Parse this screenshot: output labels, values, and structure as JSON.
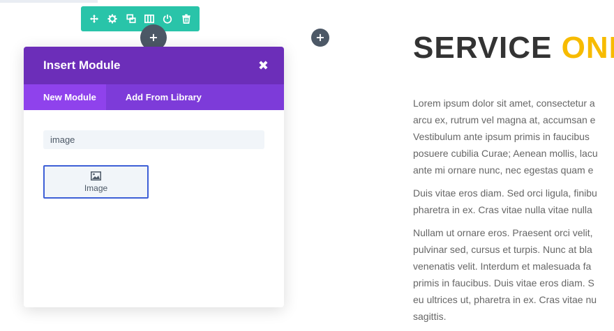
{
  "row_toolbar": {
    "icons": [
      "move-icon",
      "gear-icon",
      "duplicate-icon",
      "columns-icon",
      "power-icon",
      "trash-icon"
    ],
    "background": "#29c4a9"
  },
  "add_buttons": {
    "symbol": "+"
  },
  "modal": {
    "title": "Insert Module",
    "close_symbol": "✖",
    "tabs": [
      {
        "label": "New Module",
        "active": true
      },
      {
        "label": "Add From Library",
        "active": false
      }
    ],
    "search": {
      "value": "image",
      "placeholder": ""
    },
    "module_result": {
      "label": "Image",
      "icon": "image-icon"
    },
    "header_color": "#6c2eb9",
    "tabs_color": "#7d3bd9"
  },
  "page": {
    "heading_main": "SERVICE ",
    "heading_accent": "ONE",
    "accent_color": "#f7bb00",
    "paragraphs": [
      [
        "Lorem ipsum dolor sit amet, consectetur a",
        "arcu ex, rutrum vel magna at, accumsan e",
        "Vestibulum ante ipsum primis in faucibus",
        "posuere cubilia Curae; Aenean mollis, lacu",
        "ante mi ornare nunc, nec egestas quam e"
      ],
      [
        "Duis vitae eros diam. Sed orci ligula, finibu",
        "pharetra in ex. Cras vitae nulla vitae nulla"
      ],
      [
        "Nullam ut ornare eros. Praesent orci velit,",
        "pulvinar sed, cursus et turpis. Nunc at bla",
        "venenatis velit. Interdum et malesuada fa",
        "primis in faucibus. Duis vitae eros diam. S",
        "eu ultrices ut, pharetra in ex. Cras vitae nu",
        "sagittis."
      ]
    ]
  }
}
